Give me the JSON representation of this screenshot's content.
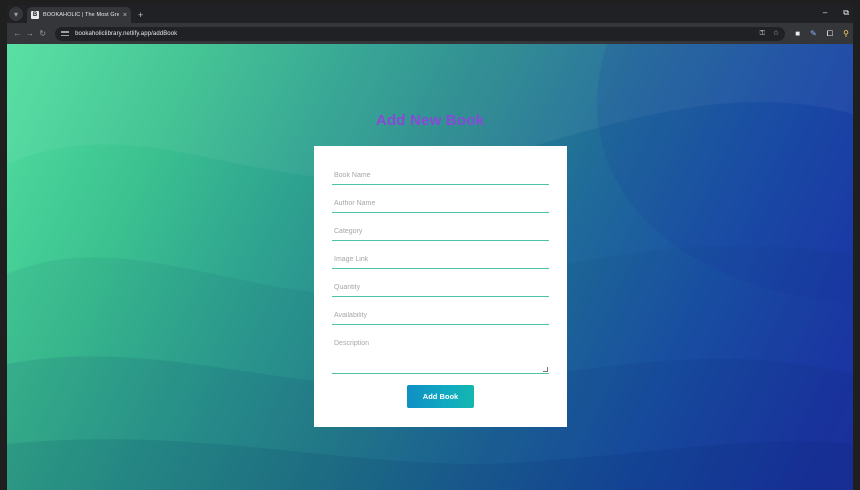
{
  "browser": {
    "tab_favicon": "B",
    "tab_title": "BOOKAHOLIC | The Most Grea",
    "tab_close": "×",
    "new_tab": "+",
    "url": "bookaholiclibrary.netlify.app/addBook",
    "window_controls": {
      "minimize": "–",
      "maximize": "⧉"
    }
  },
  "page": {
    "title": "Add New Book",
    "form": {
      "fields": [
        {
          "placeholder": "Book Name",
          "value": ""
        },
        {
          "placeholder": "Author Name",
          "value": ""
        },
        {
          "placeholder": "Category",
          "value": ""
        },
        {
          "placeholder": "Image Link",
          "value": ""
        },
        {
          "placeholder": "Quantity",
          "value": ""
        },
        {
          "placeholder": "Availability",
          "value": ""
        }
      ],
      "description_placeholder": "Description",
      "submit_label": "Add Book"
    }
  },
  "colors": {
    "title": "#8a48d8",
    "field_underline": "#4cc3a4",
    "button_start": "#0f8fc4",
    "button_end": "#14b7b0",
    "background_start": "#52dfa0",
    "background_end": "#1f2fa6"
  }
}
